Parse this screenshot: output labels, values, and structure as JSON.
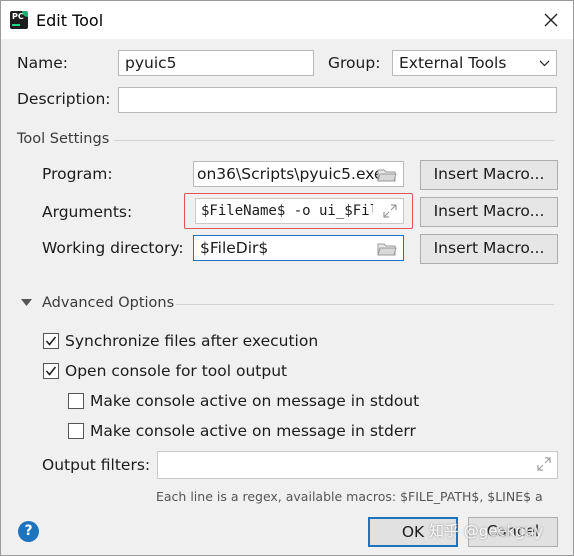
{
  "window": {
    "title": "Edit Tool",
    "app_icon_text": "PC"
  },
  "form": {
    "name_label": "Name:",
    "name_value": "pyuic5",
    "group_label": "Group:",
    "group_value": "External Tools",
    "description_label": "Description:",
    "description_value": ""
  },
  "tool_settings": {
    "section_label": "Tool Settings",
    "program_label": "Program:",
    "program_value": "on36\\Scripts\\pyuic5.exe",
    "arguments_label": "Arguments:",
    "arguments_value": "$FileName$ -o ui_$FileN",
    "working_dir_label": "Working directory:",
    "working_dir_value": "$FileDir$",
    "insert_macro_label": "Insert Macro..."
  },
  "advanced": {
    "section_label": "Advanced Options",
    "sync_files_label": "Synchronize files after execution",
    "sync_files_checked": true,
    "open_console_label": "Open console for tool output",
    "open_console_checked": true,
    "stdout_label": "Make console active on message in stdout",
    "stdout_checked": false,
    "stderr_label": "Make console active on message in stderr",
    "stderr_checked": false,
    "output_filters_label": "Output filters:",
    "output_filters_value": "",
    "hint": "Each line is a regex, available macros: $FILE_PATH$, $LINE$ a"
  },
  "footer": {
    "help_label": "?",
    "ok_label": "OK",
    "cancel_label": "Cancel",
    "watermark": "知乎 @geekguy"
  },
  "colors": {
    "accent": "#1e73be",
    "highlight": "#e05555"
  }
}
